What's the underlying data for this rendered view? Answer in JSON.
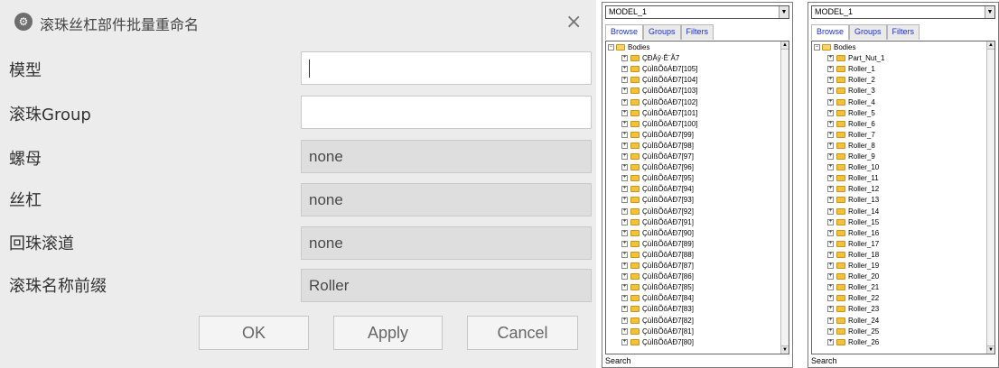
{
  "dialog": {
    "title": "滚珠丝杠部件批量重命名",
    "close_glyph": "×",
    "fields": [
      {
        "label": "模型",
        "value": "",
        "disabled": false
      },
      {
        "label": "滚珠Group",
        "value": "",
        "disabled": false
      },
      {
        "label": "螺母",
        "value": "none",
        "disabled": true
      },
      {
        "label": "丝杠",
        "value": "none",
        "disabled": true
      },
      {
        "label": "回珠滚道",
        "value": "none",
        "disabled": true
      },
      {
        "label": "滚珠名称前缀",
        "value": "Roller",
        "disabled": true
      }
    ],
    "buttons": {
      "ok": "OK",
      "apply": "Apply",
      "cancel": "Cancel"
    }
  },
  "panels": [
    {
      "model": "MODEL_1",
      "tabs": [
        "Browse",
        "Groups",
        "Filters"
      ],
      "root": "Bodies",
      "items": [
        "ÇÐÂÿ·Ê¨Ã­7",
        "ÇùÌßÕôÁÐ7[105]",
        "ÇùÌßÕôÁÐ7[104]",
        "ÇùÌßÕôÁÐ7[103]",
        "ÇùÌßÕôÁÐ7[102]",
        "ÇùÌßÕôÁÐ7[101]",
        "ÇùÌßÕôÁÐ7[100]",
        "ÇùÌßÕôÁÐ7[99]",
        "ÇùÌßÕôÁÐ7[98]",
        "ÇùÌßÕôÁÐ7[97]",
        "ÇùÌßÕôÁÐ7[96]",
        "ÇùÌßÕôÁÐ7[95]",
        "ÇùÌßÕôÁÐ7[94]",
        "ÇùÌßÕôÁÐ7[93]",
        "ÇùÌßÕôÁÐ7[92]",
        "ÇùÌßÕôÁÐ7[91]",
        "ÇùÌßÕôÁÐ7[90]",
        "ÇùÌßÕôÁÐ7[89]",
        "ÇùÌßÕôÁÐ7[88]",
        "ÇùÌßÕôÁÐ7[87]",
        "ÇùÌßÕôÁÐ7[86]",
        "ÇùÌßÕôÁÐ7[85]",
        "ÇùÌßÕôÁÐ7[84]",
        "ÇùÌßÕôÁÐ7[83]",
        "ÇùÌßÕôÁÐ7[82]",
        "ÇùÌßÕôÁÐ7[81]",
        "ÇùÌßÕôÁÐ7[80]"
      ],
      "search_label": "Search"
    },
    {
      "model": "MODEL_1",
      "tabs": [
        "Browse",
        "Groups",
        "Filters"
      ],
      "root": "Bodies",
      "items": [
        "Part_Nut_1",
        "Roller_1",
        "Roller_2",
        "Roller_3",
        "Roller_4",
        "Roller_5",
        "Roller_6",
        "Roller_7",
        "Roller_8",
        "Roller_9",
        "Roller_10",
        "Roller_11",
        "Roller_12",
        "Roller_13",
        "Roller_14",
        "Roller_15",
        "Roller_16",
        "Roller_17",
        "Roller_18",
        "Roller_19",
        "Roller_20",
        "Roller_21",
        "Roller_22",
        "Roller_23",
        "Roller_24",
        "Roller_25",
        "Roller_26"
      ],
      "search_label": "Search"
    }
  ],
  "icons": {
    "app": "gear-icon",
    "close": "close-icon",
    "folder": "folder-icon",
    "expand": "plus-icon",
    "collapse": "minus-icon",
    "dropdown": "chevron-down-icon"
  },
  "colors": {
    "tab_text": "#1a2fd0",
    "folder": "#f3c23a",
    "dialog_bg": "#ececec"
  }
}
